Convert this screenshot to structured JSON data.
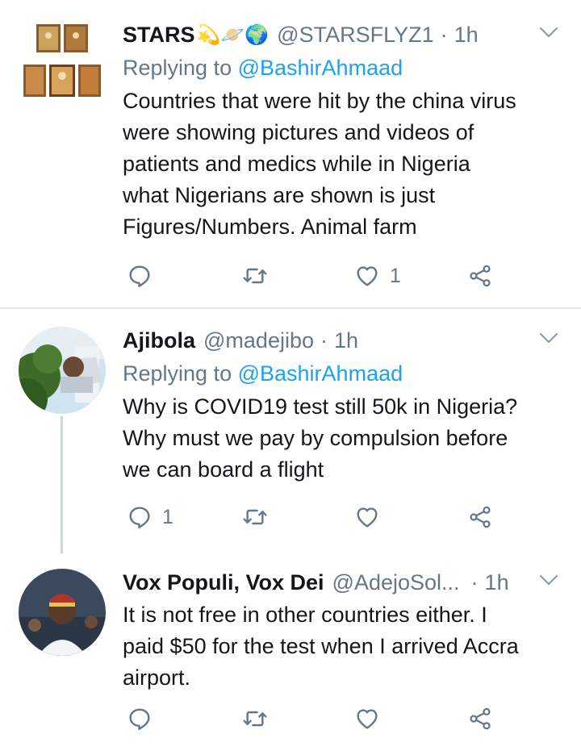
{
  "tweets": [
    {
      "name": "STARS",
      "emojis": "💫🪐🌍",
      "handle": "@STARSFLYZ1",
      "dot": "·",
      "time": "1h",
      "replying_prefix": "Replying to",
      "replying_to": "@BashirAhmaad",
      "text": "Countries that were hit by the china virus\nwere showing pictures and videos of\npatients and medics while in Nigeria\nwhat Nigerians are shown is just\nFigures/Numbers. Animal farm",
      "reply_count": "",
      "retweet_count": "",
      "like_count": "1"
    },
    {
      "name": "Ajibola",
      "handle": "@madejibo",
      "dot": "·",
      "time": "1h",
      "replying_prefix": "Replying to",
      "replying_to": "@BashirAhmaad",
      "text": "Why is COVID19 test still 50k in Nigeria?\nWhy must we pay by compulsion before\nwe can board a flight",
      "reply_count": "1",
      "retweet_count": "",
      "like_count": ""
    },
    {
      "name": "Vox Populi, Vox Dei",
      "handle": "@AdejoSol...",
      "dot": "·",
      "time": "1h",
      "text": "It is not free in other countries either. I\npaid $50 for the test when I arrived Accra\nairport.",
      "reply_count": "",
      "retweet_count": "",
      "like_count": ""
    }
  ],
  "icons": {
    "reply": "reply-icon",
    "retweet": "retweet-icon",
    "like": "heart-icon",
    "share": "share-icon",
    "menu": "chevron-down-icon"
  },
  "colors": {
    "link": "#1da1f2",
    "secondary": "#657786",
    "divider": "#e1e8ed"
  }
}
